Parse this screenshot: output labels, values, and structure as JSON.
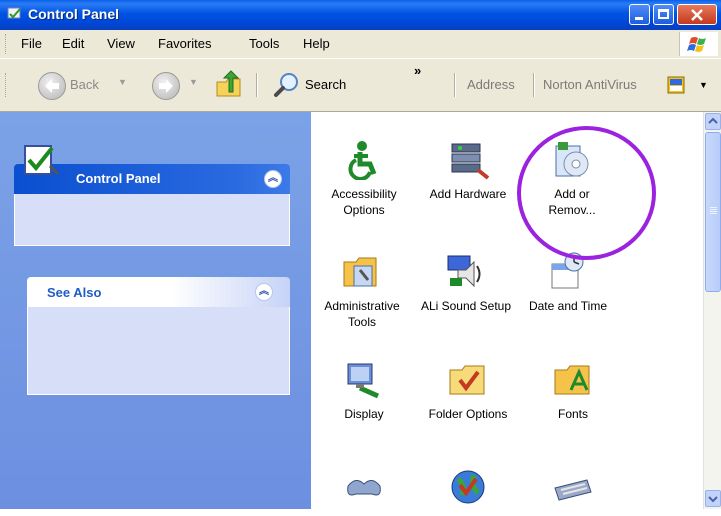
{
  "window": {
    "title": "Control Panel"
  },
  "menu": [
    "File",
    "Edit",
    "View",
    "Favorites",
    "Tools",
    "Help"
  ],
  "toolbar": {
    "back_label": "Back",
    "search_label": "Search",
    "more_label": "»",
    "address_label": "Address",
    "norton_label": "Norton AntiVirus"
  },
  "task_pane": {
    "panel_title": "Control Panel",
    "see_also_title": "See Also"
  },
  "items": [
    {
      "label": "Accessibility Options",
      "icon": "accessibility-icon"
    },
    {
      "label": "Add Hardware",
      "icon": "add-hardware-icon"
    },
    {
      "label": "Add or Remov...",
      "icon": "add-remove-programs-icon"
    },
    {
      "label": "Administrative Tools",
      "icon": "administrative-tools-icon"
    },
    {
      "label": "ALi Sound Setup",
      "icon": "sound-setup-icon"
    },
    {
      "label": "Date and Time",
      "icon": "date-time-icon"
    },
    {
      "label": "Display",
      "icon": "display-icon"
    },
    {
      "label": "Folder Options",
      "icon": "folder-options-icon"
    },
    {
      "label": "Fonts",
      "icon": "fonts-icon"
    },
    {
      "label": "",
      "icon": "game-controllers-icon"
    },
    {
      "label": "",
      "icon": "internet-options-icon"
    },
    {
      "label": "",
      "icon": "keyboard-icon"
    }
  ],
  "colors": {
    "titlebar": "#0054e3",
    "taskpane": "#7ba2e7",
    "highlight": "#9b23e0"
  }
}
